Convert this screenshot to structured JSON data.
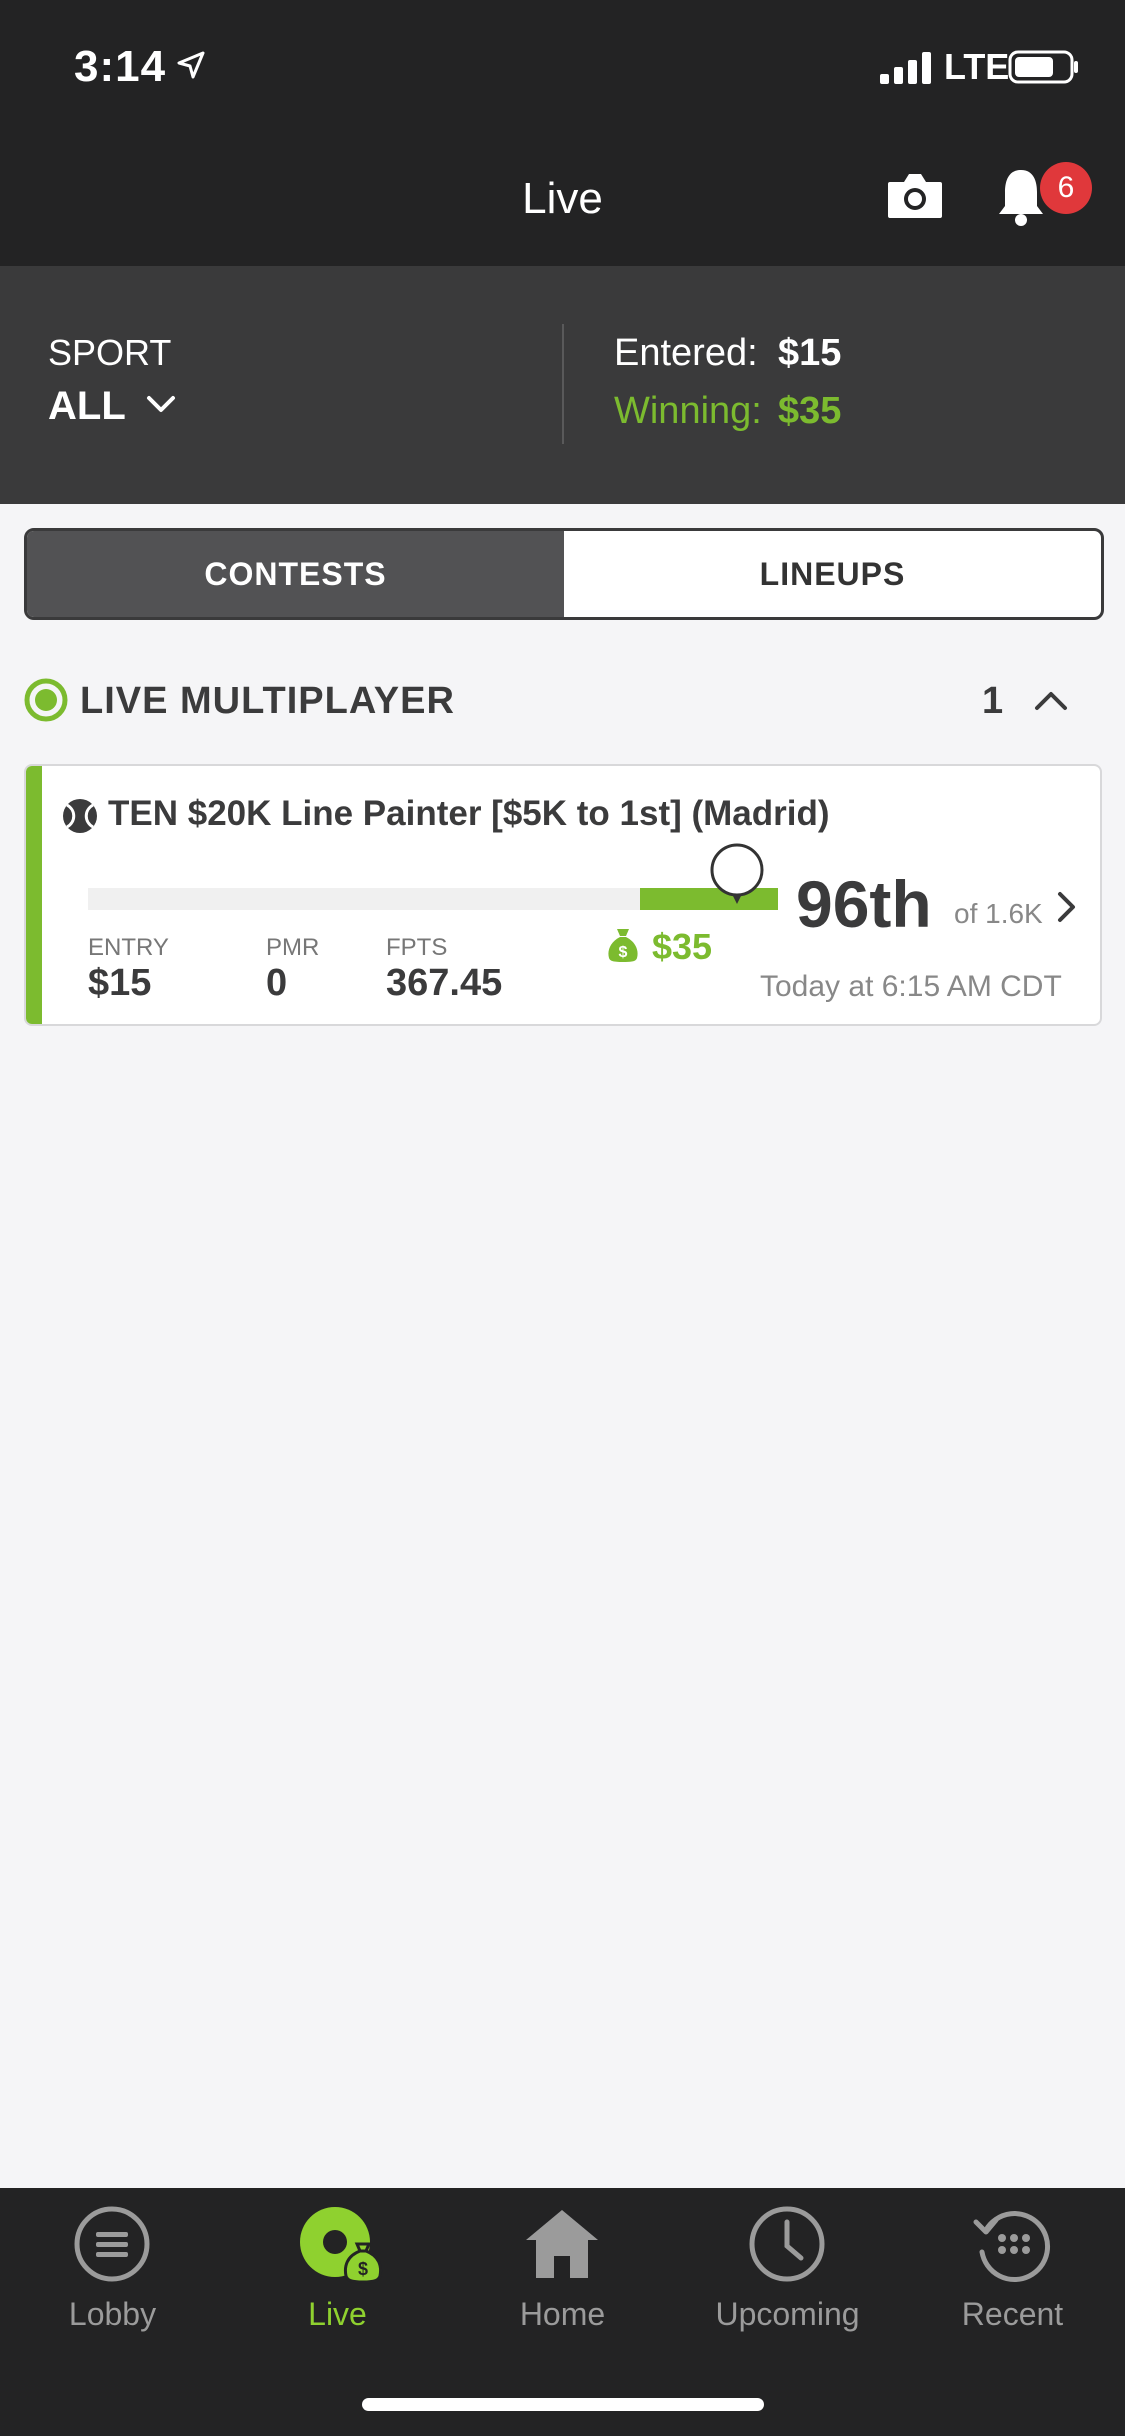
{
  "status_bar": {
    "time": "3:14",
    "network": "LTE"
  },
  "nav": {
    "title": "Live",
    "notifications_count": "6"
  },
  "summary": {
    "sport_label": "SPORT",
    "sport_value": "ALL",
    "entered_label": "Entered:",
    "entered_value": "$15",
    "winning_label": "Winning:",
    "winning_value": "$35"
  },
  "segmented": {
    "contests": "CONTESTS",
    "lineups": "LINEUPS",
    "active": "contests"
  },
  "section": {
    "title": "LIVE MULTIPLAYER",
    "count": "1"
  },
  "contest": {
    "title": "TEN $20K Line Painter [$5K to 1st] (Madrid)",
    "entry_label": "ENTRY",
    "entry_value": "$15",
    "pmr_label": "PMR",
    "pmr_value": "0",
    "fpts_label": "FPTS",
    "fpts_value": "367.45",
    "winnings": "$35",
    "rank": "96th",
    "rank_of": "of 1.6K",
    "start_time": "Today at 6:15 AM CDT",
    "progress": {
      "paid_zone_start": 0.8,
      "current_position": 0.94
    }
  },
  "tabbar": {
    "items": [
      {
        "label": "Lobby",
        "icon": "menu-icon"
      },
      {
        "label": "Live",
        "icon": "live-icon"
      },
      {
        "label": "Home",
        "icon": "home-icon"
      },
      {
        "label": "Upcoming",
        "icon": "clock-icon"
      },
      {
        "label": "Recent",
        "icon": "history-icon"
      }
    ],
    "active": 1
  },
  "colors": {
    "accent": "#7cbb2f",
    "dark": "#232324",
    "panel": "#3a3a3b",
    "badge": "#e0383b"
  }
}
